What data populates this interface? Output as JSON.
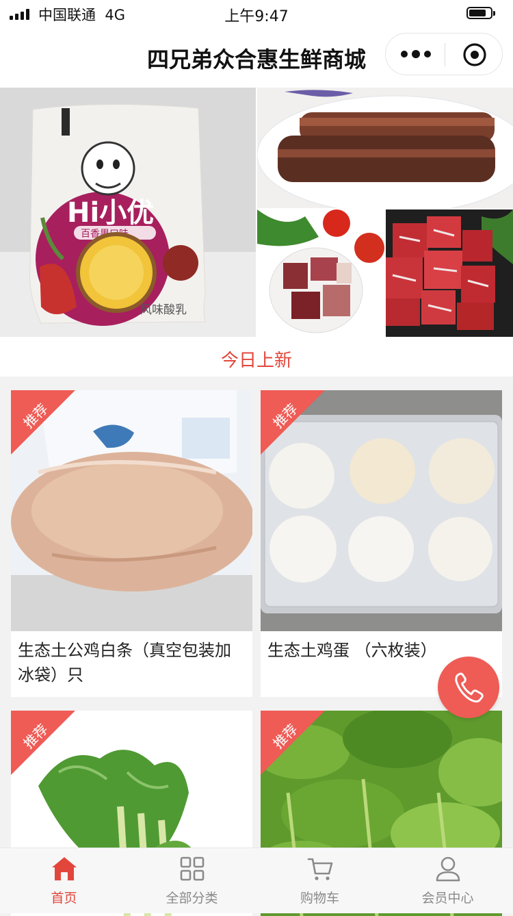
{
  "status_bar": {
    "carrier": "中国联通",
    "network": "4G",
    "time": "上午9:47"
  },
  "nav": {
    "title": "四兄弟众合惠生鲜商城",
    "more_icon": "more-dots-icon",
    "close_icon": "miniprogram-close-icon"
  },
  "banner": {
    "images": [
      "yogurt-package-image",
      "cured-pork-image",
      "cured-meat-plate-image",
      "beef-cubes-image"
    ],
    "pack_text": [
      "Hi小优",
      "百香果口味",
      "风味酸乳"
    ]
  },
  "section": {
    "title": "今日上新"
  },
  "products": [
    {
      "badge": "推荐",
      "name": "生态土公鸡白条（真空包装加冰袋）只",
      "image": "chicken-image"
    },
    {
      "badge": "推荐",
      "name": "生态土鸡蛋 （六枚装）",
      "image": "eggs-image"
    },
    {
      "badge": "推荐",
      "name": "",
      "image": "greens-image"
    },
    {
      "badge": "推荐",
      "name": "",
      "image": "choy-sum-image"
    }
  ],
  "fab": {
    "icon": "phone-icon"
  },
  "tabbar": {
    "tabs": [
      {
        "label": "首页",
        "icon": "home-icon",
        "active": true
      },
      {
        "label": "全部分类",
        "icon": "grid-icon",
        "active": false
      },
      {
        "label": "购物车",
        "icon": "cart-icon",
        "active": false
      },
      {
        "label": "会员中心",
        "icon": "user-icon",
        "active": false
      }
    ]
  },
  "colors": {
    "accent": "#e2463b",
    "ribbon": "#ef5b55",
    "fab": "#ef5b55",
    "tab_inactive": "#8a8a8a"
  }
}
